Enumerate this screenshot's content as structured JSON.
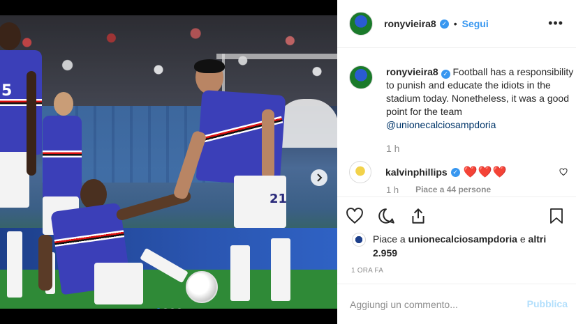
{
  "post": {
    "author": "ronyvieira8",
    "separator": "•",
    "follow_label": "Segui",
    "more_label": "•••",
    "verified_mark": "✓",
    "caption": {
      "author": "ronyvieira8",
      "text": "Football has a responsibility to punish and educate the idiots in the stadium today. Nonetheless, it was a good point for the team ",
      "mention": "@unionecalciosampdoria",
      "time": "1 h"
    },
    "comments": [
      {
        "author": "kalvinphillips",
        "text": "❤️❤️❤️",
        "time": "1 h",
        "likes": "Piace a 44 persone"
      }
    ],
    "liked_by": {
      "prefix": "Piace a ",
      "user": "unionecalciosampdoria",
      "middle": " e",
      "others": "altri 2.959"
    },
    "date": "1 ORA FA",
    "add_comment_placeholder": "Aggiungi un commento...",
    "publish_label": "Pubblica"
  },
  "photo": {
    "jersey_numbers": [
      "5",
      "21"
    ],
    "carousel": {
      "count": 4,
      "active": 0
    }
  },
  "colors": {
    "accent": "#3897f0",
    "heart": "#e0245e",
    "sampdoria_blue": "#3b3fb8"
  },
  "icons": {
    "like": "heart-icon",
    "comment": "comment-bubble-icon",
    "share": "share-icon",
    "save": "bookmark-icon",
    "next": "chevron-right-icon"
  }
}
